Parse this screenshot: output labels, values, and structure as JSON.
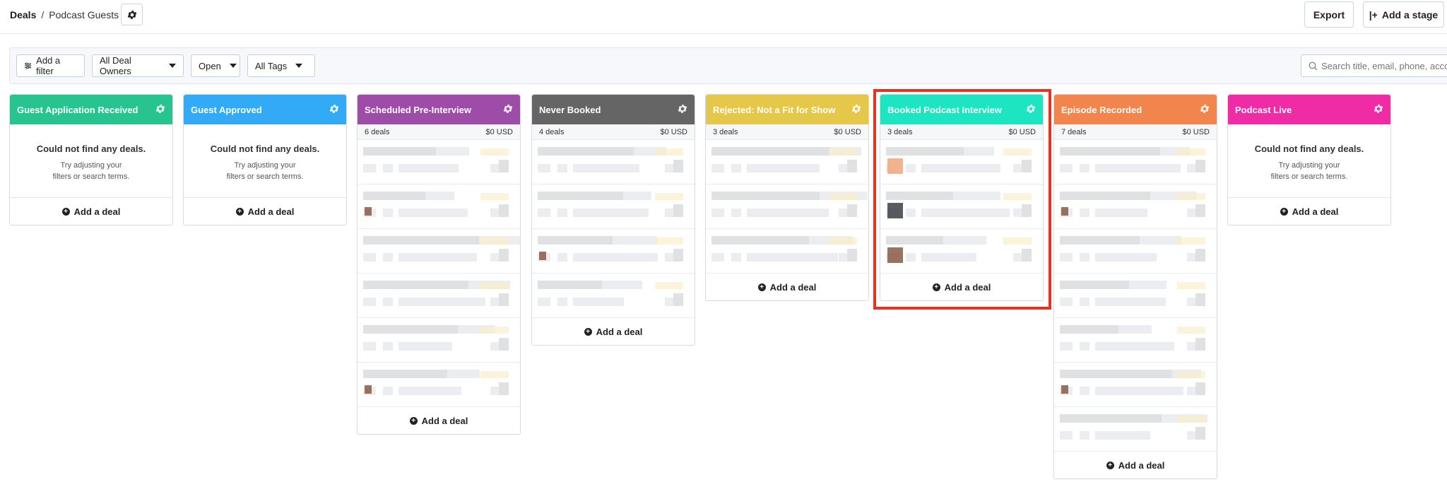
{
  "breadcrumb": {
    "root": "Deals",
    "separator": "/",
    "pipeline": "Podcast Guests"
  },
  "toolbar": {
    "export_label": "Export",
    "add_stage_label": "Add a stage"
  },
  "filters": {
    "add_filter_label": "Add a filter",
    "owner": "All Deal Owners",
    "status": "Open",
    "tags": "All Tags",
    "search_placeholder": "Search title, email, phone, account"
  },
  "empty_state": {
    "title": "Could not find any deals.",
    "line1": "Try adjusting your",
    "line2": "filters or search terms."
  },
  "add_deal_label": "Add a deal",
  "colors": {
    "highlight": "#e8321f"
  },
  "stages": [
    {
      "name": "Guest Application Received",
      "color": "#27c490",
      "deals": "",
      "amount": "",
      "cards": 0
    },
    {
      "name": "Guest Approved",
      "color": "#33aaf5",
      "deals": "",
      "amount": "",
      "cards": 0
    },
    {
      "name": "Scheduled Pre-Interview",
      "color": "#9d4ca8",
      "deals": "6 deals",
      "amount": "$0 USD",
      "cards": 6
    },
    {
      "name": "Never Booked",
      "color": "#656565",
      "deals": "4 deals",
      "amount": "$0 USD",
      "cards": 4
    },
    {
      "name": "Rejected: Not a Fit for Show",
      "color": "#e5c74a",
      "deals": "3 deals",
      "amount": "$0 USD",
      "cards": 3
    },
    {
      "name": "Booked Podcast Interview",
      "color": "#1de5c1",
      "deals": "3 deals",
      "amount": "$0 USD",
      "cards": 3
    },
    {
      "name": "Episode Recorded",
      "color": "#f2844e",
      "deals": "7 deals",
      "amount": "$0 USD",
      "cards": 7
    },
    {
      "name": "Podcast Live",
      "color": "#f02ba6",
      "deals": "",
      "amount": "",
      "cards": 0
    }
  ]
}
